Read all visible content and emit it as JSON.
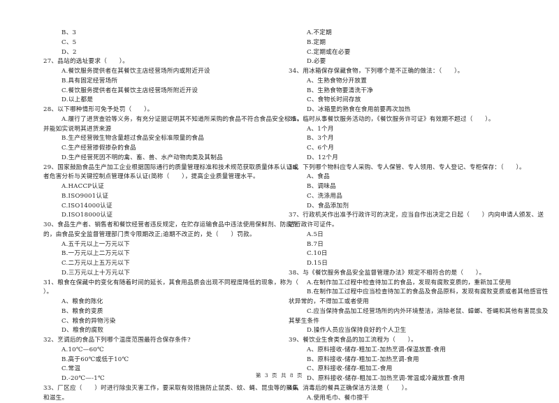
{
  "left_column": [
    {
      "type": "opt",
      "text": "B、3"
    },
    {
      "type": "opt",
      "text": "C、5"
    },
    {
      "type": "opt",
      "text": "D、2"
    },
    {
      "type": "q",
      "text": "27、品站的选址要求（　　）。"
    },
    {
      "type": "opt",
      "text": "A.餐饮服务提供者在其餐饮主店经营场所内或附近开设"
    },
    {
      "type": "opt",
      "text": "B.具有固定经营场所"
    },
    {
      "type": "opt",
      "text": "C.餐饮服务提供者在其餐饮主店经营场所附近开设"
    },
    {
      "type": "opt",
      "text": "D.以上都是"
    },
    {
      "type": "q",
      "text": "28、以下哪种情形可免予处罚（　　）。"
    },
    {
      "type": "opt",
      "text": "A.履行了进货查验等义务，有充分证据证明其不知道所采购的食品不符合食品安全标准，"
    },
    {
      "type": "cont",
      "text": "并能如实说明其进货来源"
    },
    {
      "type": "opt",
      "text": "B.生产经营微生物含量超过食品安全标准限量的食品"
    },
    {
      "type": "opt",
      "text": "C.生产经营掺假掺杂的食品"
    },
    {
      "type": "opt",
      "text": "D.生产经营死因不明的禽、畜、兽、水产动物肉类及其制品"
    },
    {
      "type": "q",
      "text": "29、国家鼓励食品生产加工企业根据国际通行的质量管理标准和技术规范获取质量体系认证或"
    },
    {
      "type": "cont",
      "text": "者危害分析与关键控制点管理体系认证(简称（　　），提高企业质量管理水平。"
    },
    {
      "type": "opt",
      "text": "A.HACCP认证"
    },
    {
      "type": "opt",
      "text": "B.ISO9001认证"
    },
    {
      "type": "opt",
      "text": "C.ISO14000认证"
    },
    {
      "type": "opt",
      "text": "D.ISO18000认证"
    },
    {
      "type": "q",
      "text": "30、食品生产者、销售者和餐饮经营者违反规定，在贮存运输食品中违法使用保鲜剂、防腐剂"
    },
    {
      "type": "cont",
      "text": "的，由食品安全监督管理部门责令限期改正;逾期不改正的，处（　　）罚款。"
    },
    {
      "type": "opt",
      "text": "A.五千元以上一万元以下"
    },
    {
      "type": "opt",
      "text": "B.一万元以上二万元以下"
    },
    {
      "type": "opt",
      "text": "C.二万元以上五万元以下"
    },
    {
      "type": "opt",
      "text": "D.三万元以上十万元以下"
    },
    {
      "type": "q",
      "text": "31、粮食在保藏中的变化有随着时间的延长，其食用品质会出现不同程度降低的现象，称为（"
    },
    {
      "type": "cont",
      "text": "）。"
    },
    {
      "type": "opt",
      "text": "A、粮食的陈化"
    },
    {
      "type": "opt",
      "text": "B、粮食的变质"
    },
    {
      "type": "opt",
      "text": "C、粮食的异物污染"
    },
    {
      "type": "opt",
      "text": "D、粮食的腐败"
    },
    {
      "type": "q",
      "text": "32、烹调后的食品下列哪个温度范围最符合保存条件?"
    },
    {
      "type": "opt",
      "text": "A.10℃—60℃"
    },
    {
      "type": "opt",
      "text": "B.高于60℃或低于10℃"
    },
    {
      "type": "opt",
      "text": "C.常温"
    },
    {
      "type": "opt",
      "text": "D.-20℃—-1℃"
    },
    {
      "type": "q",
      "text": "33、厂区应（　　）时进行除虫灭害工作，要采取有效措施防止鼠类、蚊、蝇、昆虫等的聚集"
    },
    {
      "type": "cont",
      "text": "和滋生。"
    }
  ],
  "right_column": [
    {
      "type": "opt",
      "text": "A.不定期"
    },
    {
      "type": "opt",
      "text": "B.定期"
    },
    {
      "type": "opt",
      "text": "C.定期或在必要"
    },
    {
      "type": "opt",
      "text": "D.必要"
    },
    {
      "type": "q",
      "text": "34、用冰箱保存保藏食物，下列哪个是不正确的做法：（　　）。"
    },
    {
      "type": "opt",
      "text": "A、生熟食物分开放置"
    },
    {
      "type": "opt",
      "text": "B、生熟食物要清洗干净"
    },
    {
      "type": "opt",
      "text": "C、食物长时间存放"
    },
    {
      "type": "opt",
      "text": "D、冰箱里的熟食在食用前要再次加热"
    },
    {
      "type": "q",
      "text": "35、临时从事餐饮服务活动的，《餐饮服务许可证》有效期不超过（　　）。"
    },
    {
      "type": "opt",
      "text": "A、1个月"
    },
    {
      "type": "opt",
      "text": "B、3个月"
    },
    {
      "type": "opt",
      "text": "C、6个月"
    },
    {
      "type": "opt",
      "text": "D、12个月"
    },
    {
      "type": "q",
      "text": "36、下列哪个物料应专人采购、专人保管、专人领用、专人登记、专柜保存：（　　）。"
    },
    {
      "type": "opt",
      "text": "A、食品"
    },
    {
      "type": "opt",
      "text": "B、调味品"
    },
    {
      "type": "opt",
      "text": "C、洗涤用品"
    },
    {
      "type": "opt",
      "text": "D、食品添加剂"
    },
    {
      "type": "q",
      "text": "37、行政机关作出准予行政许可的决定，应当自作出决定之日起（　　）内向申请人颁发、送"
    },
    {
      "type": "cont",
      "text": "达行政许可证件。"
    },
    {
      "type": "opt",
      "text": "A.5日"
    },
    {
      "type": "opt",
      "text": "B.7日"
    },
    {
      "type": "opt",
      "text": "C.10日"
    },
    {
      "type": "opt",
      "text": "D.15日"
    },
    {
      "type": "q",
      "text": "38、与《餐饮服务食品安全监督管理办法》规定不相符合的是（　　）。"
    },
    {
      "type": "opt",
      "text": "A.在制作加工过程中检查待加工的食品，发现有腐败变质的，重新加工使用"
    },
    {
      "type": "opt",
      "text": "B.在制作加工过程中应当检查待加工的食品及食品原料，发现有腐败变质或者其他感官性"
    },
    {
      "type": "cont",
      "text": "状异常的，不得加工或者使用"
    },
    {
      "type": "opt",
      "text": "C.应当保持食品加工经营场所的内外环境整洁，消除老鼠、蟑螂、苍蝇和其他有害昆虫及"
    },
    {
      "type": "cont",
      "text": "其孳生条件"
    },
    {
      "type": "opt",
      "text": "D.操作人员应当保持良好的个人卫生"
    },
    {
      "type": "q",
      "text": "39、餐饮业生食类食品的加工流程为（　　）。"
    },
    {
      "type": "opt",
      "text": "A、原料接收-储存-粗加工-加热烹调-保温放置-食用"
    },
    {
      "type": "opt",
      "text": "B、原料接收-储存-粗加工-加热烹调-食用"
    },
    {
      "type": "opt",
      "text": "C、原料接收-储存-粗加工-食用"
    },
    {
      "type": "opt",
      "text": "D、原料接收-储存-粗加工-加热烹调-常温或冷藏放置-食用"
    },
    {
      "type": "q",
      "text": "40、消毒后的餐具正确保洁方法是（　　）。"
    },
    {
      "type": "opt",
      "text": "A.使用毛巾、餐巾擦干"
    }
  ],
  "footer": {
    "text": "第 3 页 共 8 页"
  }
}
